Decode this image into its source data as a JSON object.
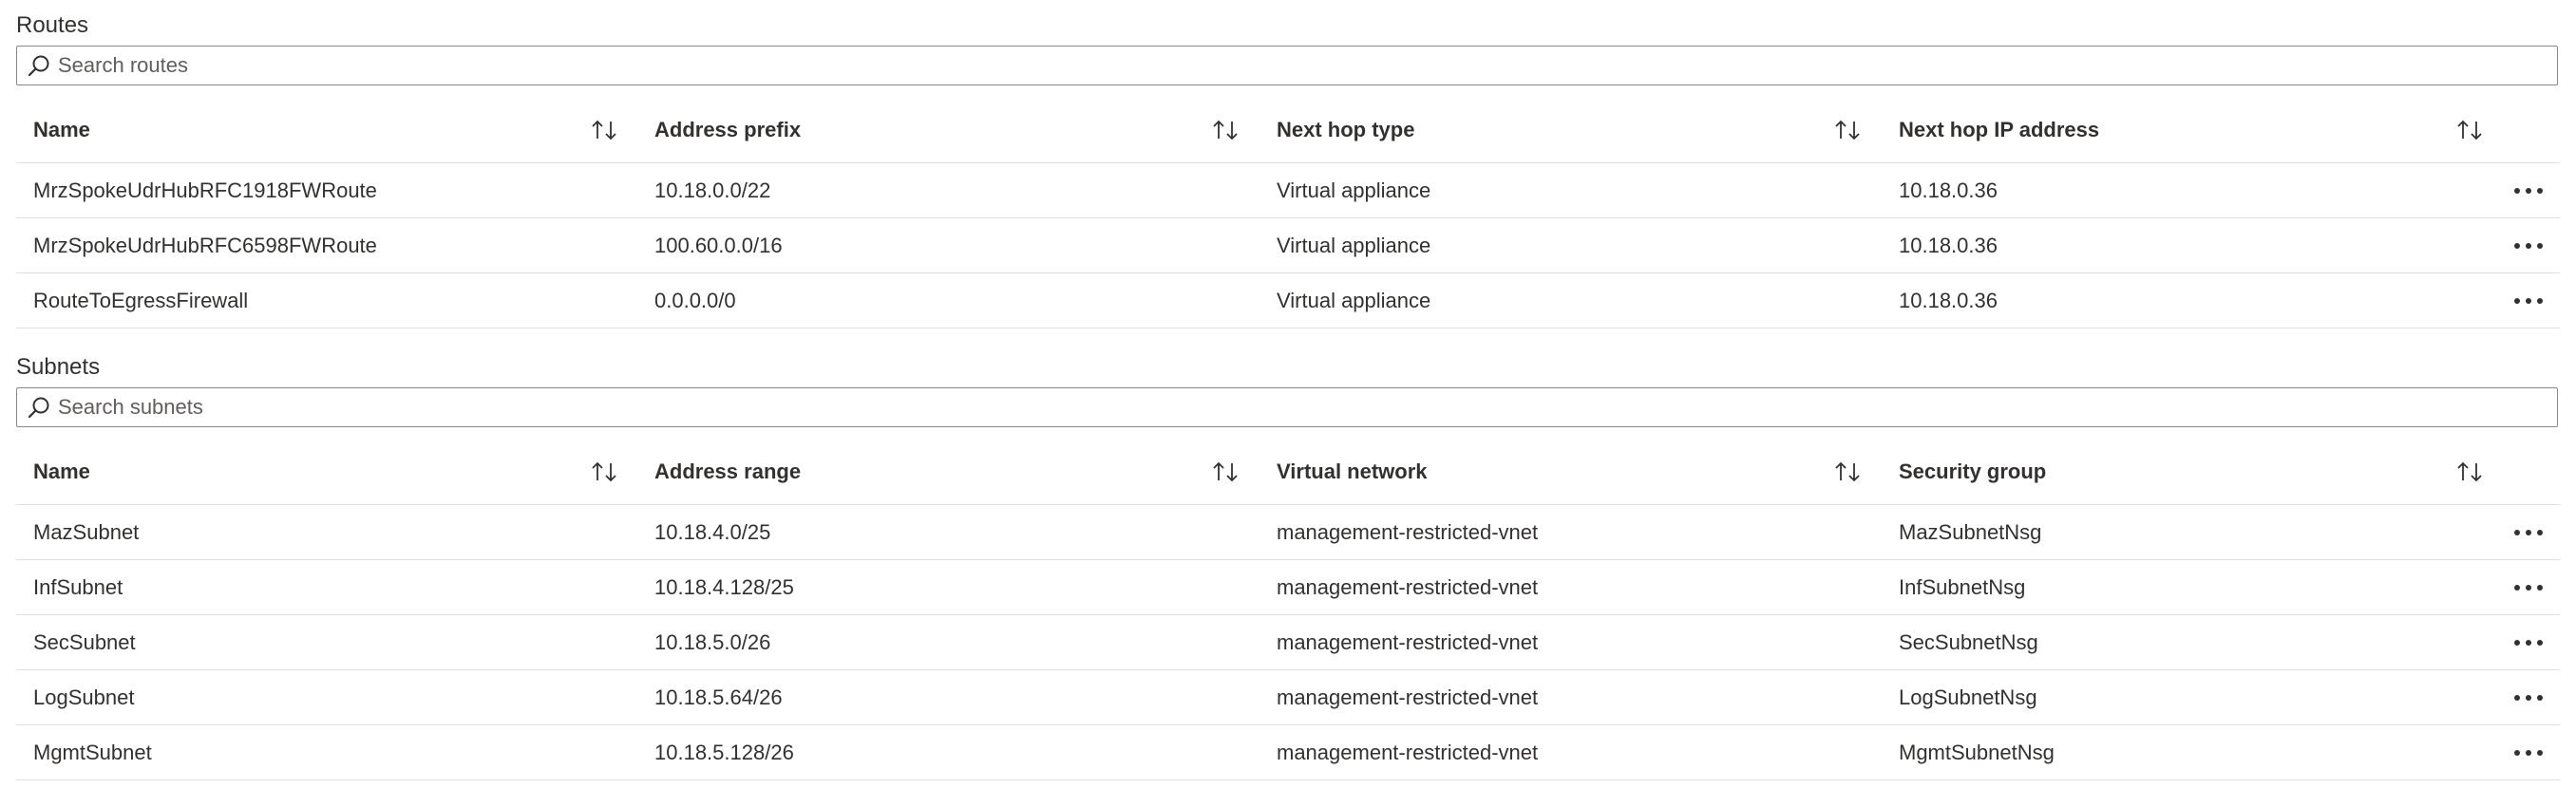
{
  "routes": {
    "title": "Routes",
    "search_placeholder": "Search routes",
    "columns": [
      "Name",
      "Address prefix",
      "Next hop type",
      "Next hop IP address"
    ],
    "rows": [
      [
        "MrzSpokeUdrHubRFC1918FWRoute",
        "10.18.0.0/22",
        "Virtual appliance",
        "10.18.0.36"
      ],
      [
        "MrzSpokeUdrHubRFC6598FWRoute",
        "100.60.0.0/16",
        "Virtual appliance",
        "10.18.0.36"
      ],
      [
        "RouteToEgressFirewall",
        "0.0.0.0/0",
        "Virtual appliance",
        "10.18.0.36"
      ]
    ]
  },
  "subnets": {
    "title": "Subnets",
    "search_placeholder": "Search subnets",
    "columns": [
      "Name",
      "Address range",
      "Virtual network",
      "Security group"
    ],
    "rows": [
      [
        "MazSubnet",
        "10.18.4.0/25",
        "management-restricted-vnet",
        "MazSubnetNsg"
      ],
      [
        "InfSubnet",
        "10.18.4.128/25",
        "management-restricted-vnet",
        "InfSubnetNsg"
      ],
      [
        "SecSubnet",
        "10.18.5.0/26",
        "management-restricted-vnet",
        "SecSubnetNsg"
      ],
      [
        "LogSubnet",
        "10.18.5.64/26",
        "management-restricted-vnet",
        "LogSubnetNsg"
      ],
      [
        "MgmtSubnet",
        "10.18.5.128/26",
        "management-restricted-vnet",
        "MgmtSubnetNsg"
      ]
    ]
  },
  "icons": {
    "search": "search-icon",
    "sort": "sort-icon",
    "more": "more-actions-icon"
  },
  "colors": {
    "text": "#323130",
    "border": "#8a8886",
    "row_divider": "#e1dfdd",
    "placeholder": "#605e5c"
  }
}
